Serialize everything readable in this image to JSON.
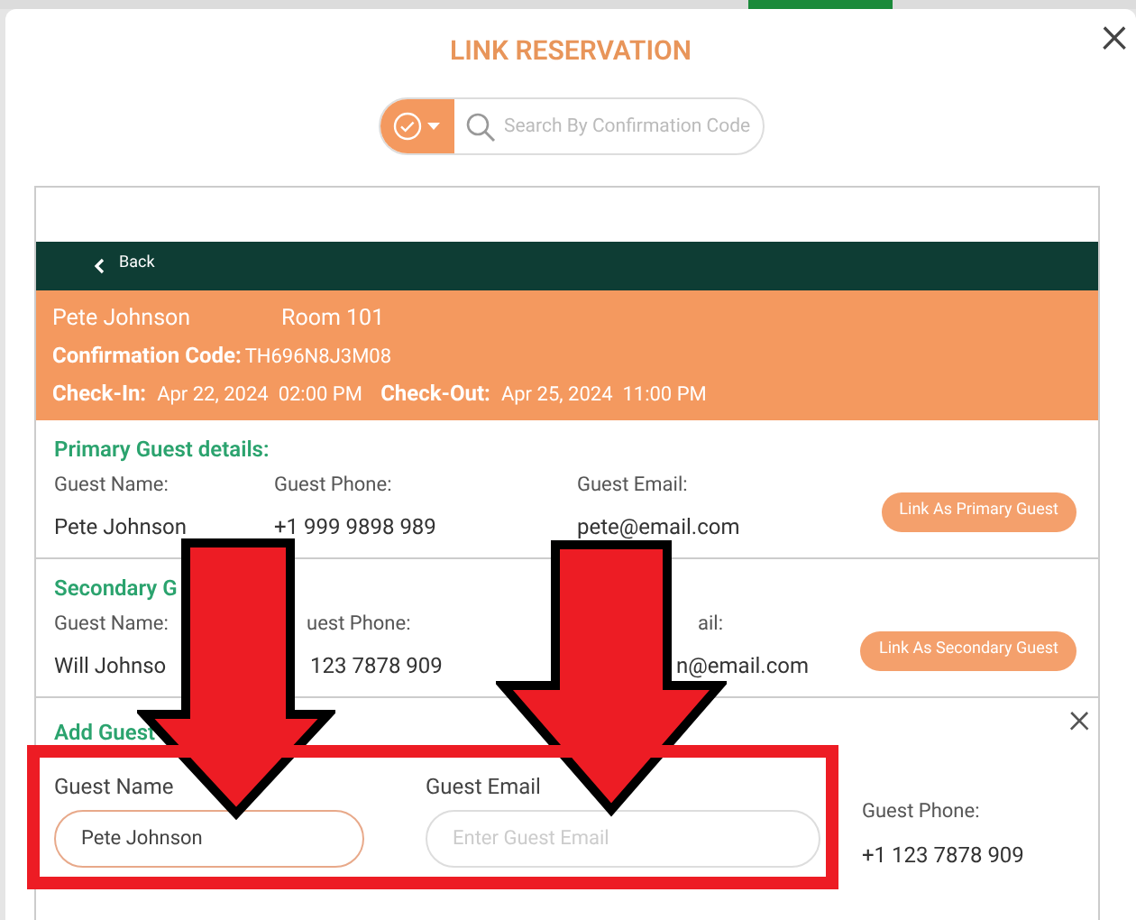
{
  "dialog": {
    "title": "LINK RESERVATION",
    "close": "×"
  },
  "search": {
    "placeholder": "Search By Confirmation Code"
  },
  "back_button": "Back",
  "reservation": {
    "guest": "Pete Johnson",
    "room": "Room 101",
    "confirmation_label": "Confirmation Code:",
    "confirmation_code": "TH696N8J3M08",
    "checkin_label": "Check-In:",
    "checkin": "Apr 22, 2024  02:00 PM",
    "checkout_label": "Check-Out:",
    "checkout": "Apr 25, 2024  11:00 PM"
  },
  "guest_sections": [
    {
      "title": "Primary Guest details:",
      "name_label": "Guest Name:",
      "phone_label": "Guest Phone:",
      "email_label": "Guest Email:",
      "name": "Pete Johnson",
      "phone": "+1 999 9898 989",
      "email": "pete@email.com",
      "button": "Link As Primary Guest"
    },
    {
      "title": "Secondary G",
      "name_label": "Guest Name:",
      "phone_label": "uest Phone:",
      "email_label": "ail:",
      "name": "Will Johnso",
      "phone": "123 7878 909",
      "email": "n@email.com",
      "button": "Link As Secondary Guest"
    }
  ],
  "add_guest": {
    "title": "Add Guest",
    "close": "×",
    "name_label": "Guest Name",
    "name_value": "Pete Johnson",
    "email_label": "Guest Email",
    "email_placeholder": "Enter Guest Email",
    "phone_label": "Guest Phone:",
    "phone": "+1 123 7878 909"
  }
}
